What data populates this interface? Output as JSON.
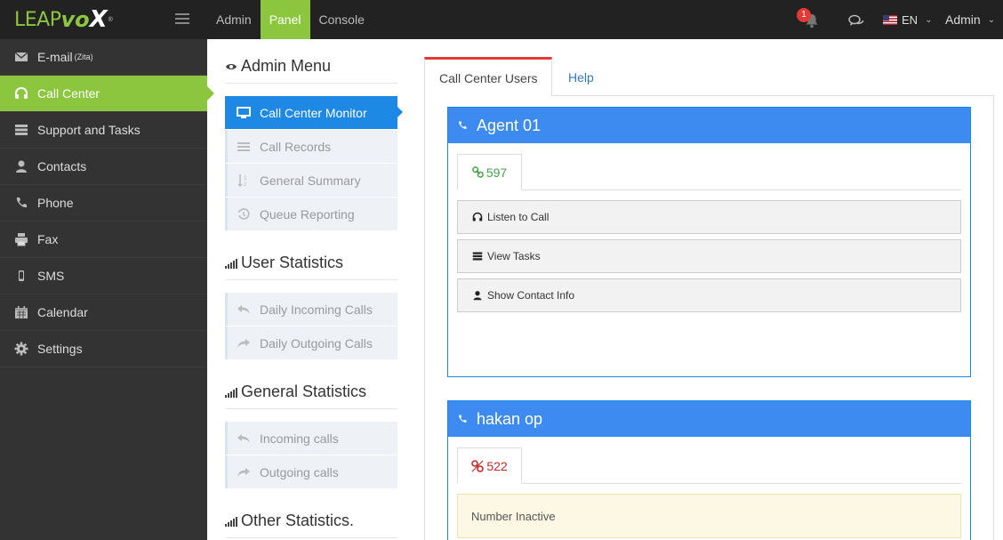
{
  "brand": {
    "leap": "LEAP",
    "vo": "vo",
    "x": "X",
    "reg": "®"
  },
  "topnav": [
    {
      "label": "Admin",
      "active": false
    },
    {
      "label": "Panel",
      "active": true
    },
    {
      "label": "Console",
      "active": false
    }
  ],
  "notifications": {
    "count": "1"
  },
  "language": {
    "code": "EN"
  },
  "user": {
    "name": "Admin"
  },
  "colors": {
    "accent": "#8cc63f",
    "primary": "#1e88e5",
    "agent_header": "#3d8bf0",
    "tab_active_border": "#e53935"
  },
  "sidebar": {
    "items": [
      {
        "label": "E-mail",
        "sup": "(Zita)",
        "icon": "envelope-icon",
        "active": false
      },
      {
        "label": "Call Center",
        "icon": "headphones-icon",
        "active": true
      },
      {
        "label": "Support and Tasks",
        "icon": "tasks-icon",
        "active": false
      },
      {
        "label": "Contacts",
        "icon": "user-icon",
        "active": false
      },
      {
        "label": "Phone",
        "icon": "phone-icon",
        "active": false
      },
      {
        "label": "Fax",
        "icon": "printer-icon",
        "active": false
      },
      {
        "label": "SMS",
        "icon": "mobile-icon",
        "active": false
      },
      {
        "label": "Calendar",
        "icon": "calendar-icon",
        "active": false
      },
      {
        "label": "Settings",
        "icon": "gear-icon",
        "active": false
      }
    ]
  },
  "admin_menu": {
    "title": "Admin Menu",
    "items": [
      {
        "label": "Call Center Monitor",
        "icon": "monitor-icon",
        "active": true
      },
      {
        "label": "Call Records",
        "icon": "list-icon",
        "active": false
      },
      {
        "label": "General Summary",
        "icon": "sort-icon",
        "active": false
      },
      {
        "label": "Queue Reporting",
        "icon": "history-icon",
        "active": false
      }
    ]
  },
  "user_statistics": {
    "title": "User Statistics",
    "items": [
      {
        "label": "Daily Incoming Calls",
        "icon": "reply-icon"
      },
      {
        "label": "Daily Outgoing Calls",
        "icon": "forward-icon"
      }
    ]
  },
  "general_statistics": {
    "title": "General Statistics",
    "items": [
      {
        "label": "Incoming calls",
        "icon": "reply-icon"
      },
      {
        "label": "Outgoing calls",
        "icon": "forward-icon"
      }
    ]
  },
  "other_statistics": {
    "title": "Other Statistics."
  },
  "main_tabs": [
    {
      "label": "Call Center Users",
      "active": true
    },
    {
      "label": "Help",
      "active": false
    }
  ],
  "agents": [
    {
      "name": "Agent 01",
      "extension": "597",
      "status": "active",
      "actions": [
        {
          "label": "Listen to Call",
          "icon": "headphones-icon"
        },
        {
          "label": "View Tasks",
          "icon": "tasks-icon"
        },
        {
          "label": "Show Contact Info",
          "icon": "user-icon"
        }
      ]
    },
    {
      "name": "hakan op",
      "extension": "522",
      "status": "inactive",
      "message": "Number Inactive"
    }
  ]
}
